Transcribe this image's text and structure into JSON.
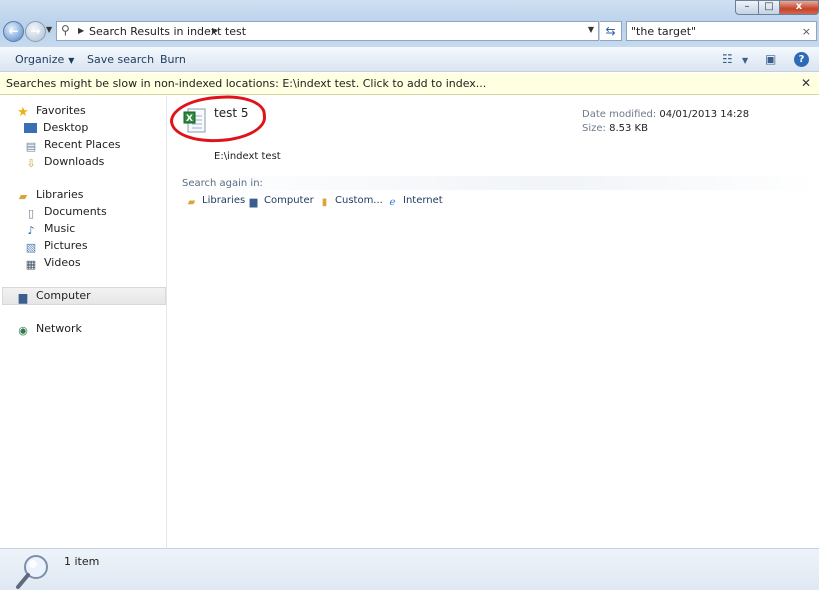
{
  "address_bar": {
    "path": "Search Results in indext test"
  },
  "search_box": {
    "value": "\"the target\""
  },
  "window_controls": {
    "minimize": "–",
    "maximize": "□",
    "close": "x"
  },
  "toolbar": {
    "organize": "Organize",
    "save_search": "Save search",
    "burn": "Burn"
  },
  "info_bar": {
    "message": "Searches might be slow in non-indexed locations: E:\\indext test. Click to add to index..."
  },
  "nav_pane": {
    "favorites": "Favorites",
    "desktop": "Desktop",
    "recent_places": "Recent Places",
    "downloads": "Downloads",
    "libraries": "Libraries",
    "documents": "Documents",
    "music": "Music",
    "pictures": "Pictures",
    "videos": "Videos",
    "computer": "Computer",
    "network": "Network"
  },
  "result": {
    "name": "test 5",
    "date_modified_label": "Date modified:",
    "date_modified": "04/01/2013 14:28",
    "size_label": "Size:",
    "size": "8.53 KB",
    "location": "E:\\indext test"
  },
  "search_again": {
    "label": "Search again in:",
    "libraries": "Libraries",
    "computer": "Computer",
    "custom": "Custom...",
    "internet": "Internet"
  },
  "status": {
    "count": "1 item"
  },
  "colors": {
    "annotation_circle": "#e0121a",
    "info_bar_bg": "#ffffe1"
  }
}
